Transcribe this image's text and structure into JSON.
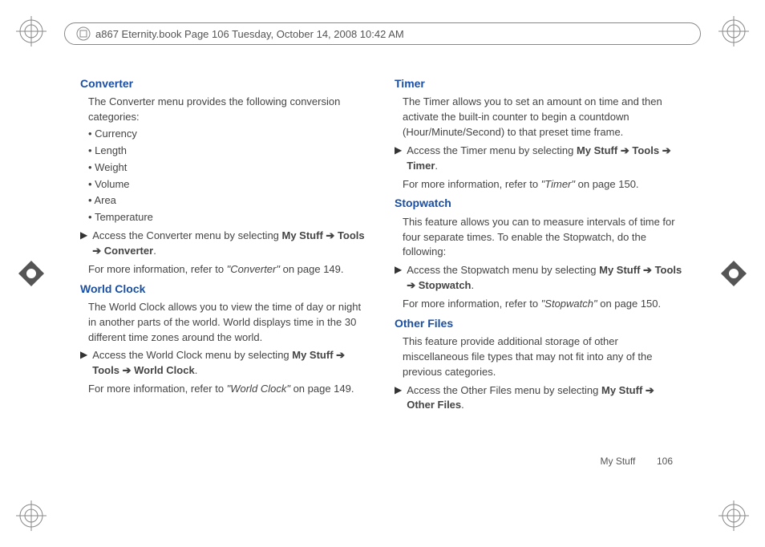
{
  "header": {
    "text": "a867 Eternity.book  Page 106  Tuesday, October 14, 2008  10:42 AM"
  },
  "leftColumn": {
    "converter": {
      "heading": "Converter",
      "intro": "The Converter menu provides the following conversion categories:",
      "bullets": [
        "Currency",
        "Length",
        "Weight",
        "Volume",
        "Area",
        "Temperature"
      ],
      "action_pre": "Access the Converter menu by selecting ",
      "action_path1": "My Stuff",
      "action_path2": "Tools",
      "action_path3": "Converter",
      "ref_pre": "For more information, refer to ",
      "ref_title": "\"Converter\"",
      "ref_post": "  on page 149."
    },
    "worldClock": {
      "heading": "World Clock",
      "intro": "The World Clock allows you to view the time of day or night in another parts of the world. World displays time in the 30 different time zones around the world.",
      "action_pre": "Access the World Clock menu by selecting ",
      "action_path1": "My Stuff",
      "action_path2": "Tools",
      "action_path3": "World Clock",
      "ref_pre": "For more information, refer to ",
      "ref_title": "\"World Clock\"",
      "ref_post": "  on page 149."
    }
  },
  "rightColumn": {
    "timer": {
      "heading": "Timer",
      "intro": "The Timer allows you to set an amount on time and then activate the built-in counter to begin a countdown (Hour/Minute/Second) to that preset time frame.",
      "action_pre": "Access the Timer menu by selecting ",
      "action_path1": "My Stuff",
      "action_path2": "Tools",
      "action_path3": "Timer",
      "ref_pre": "For more information, refer to ",
      "ref_title": "\"Timer\"",
      "ref_post": "  on page 150."
    },
    "stopwatch": {
      "heading": "Stopwatch",
      "intro": "This feature allows you can to measure intervals of time for four separate times. To enable the Stopwatch, do the following:",
      "action_pre": "Access the Stopwatch menu by selecting ",
      "action_path1": "My Stuff",
      "action_path2": "Tools",
      "action_path3": "Stopwatch",
      "ref_pre": "For more information, refer to ",
      "ref_title": "\"Stopwatch\"",
      "ref_post": "  on page 150."
    },
    "otherFiles": {
      "heading": "Other Files",
      "intro": "This feature provide additional storage of other miscellaneous file types that may not fit into any of the previous categories.",
      "action_pre": "Access the Other Files menu by selecting ",
      "action_path1": "My Stuff",
      "action_path2": "Other Files"
    }
  },
  "footer": {
    "section": "My Stuff",
    "pageNum": "106"
  },
  "glyphs": {
    "arrow": "➔",
    "play": "▶"
  }
}
